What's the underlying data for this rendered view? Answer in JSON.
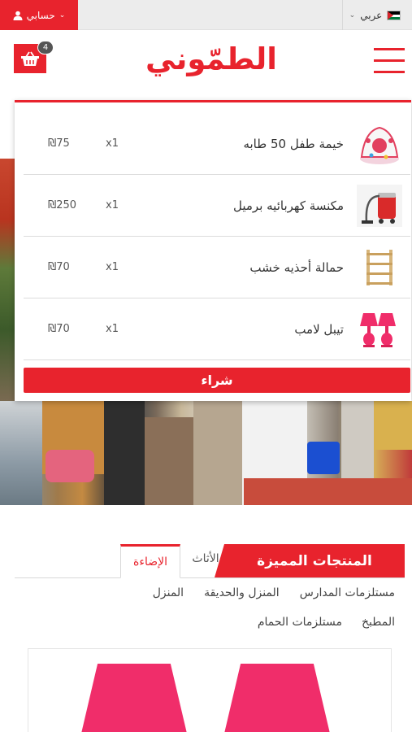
{
  "topbar": {
    "account_label": "حسابي",
    "language_label": "عربي"
  },
  "header": {
    "logo_text": "الطمّوني",
    "cart_count": "4"
  },
  "cart": {
    "items": [
      {
        "name": "خيمة طفل 50 طابه",
        "qty": "x1",
        "price": "₪75"
      },
      {
        "name": "مكنسة كهربائيه برميل",
        "qty": "x1",
        "price": "₪250"
      },
      {
        "name": "حمالة أحذيه خشب",
        "qty": "x1",
        "price": "₪70"
      },
      {
        "name": "تيبل لامب",
        "qty": "x1",
        "price": "₪70"
      }
    ],
    "buy_label": "شراء"
  },
  "featured": {
    "title": "المنتجات المميزة",
    "tabs": [
      "الأثاث",
      "الإضاءة"
    ],
    "sublinks_row1": [
      "مستلزمات المدارس",
      "المنزل والحديقة",
      "المنزل"
    ],
    "sublinks_row2": [
      "المطبخ",
      "مستلزمات الحمام"
    ]
  },
  "colors": {
    "brand_red": "#e8232d",
    "lamp_pink": "#f02d6a"
  }
}
